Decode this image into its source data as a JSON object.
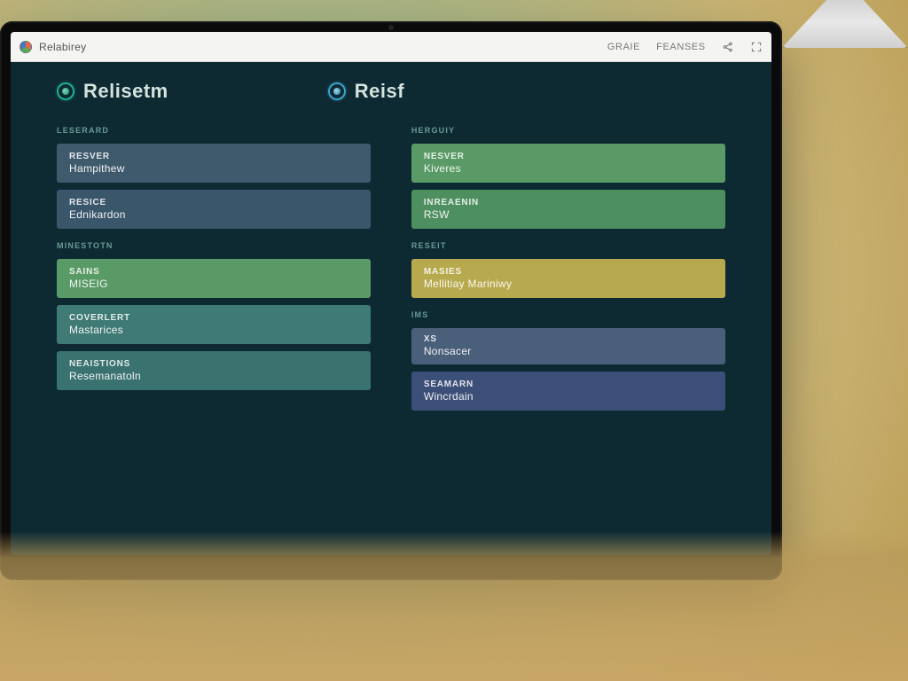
{
  "browser": {
    "title": "Relabirey",
    "nav": {
      "link1": "GRAIE",
      "link2": "FEANSES"
    }
  },
  "tabs": {
    "primary": "Relisetm",
    "secondary": "Reisf"
  },
  "left": {
    "sec1": {
      "label": "LESERARD"
    },
    "card1": {
      "line1": "Resver",
      "line2": "Hampithew"
    },
    "card2": {
      "line1": "Resice",
      "line2": "Ednikardon"
    },
    "sec2": {
      "label": "MINESTOTN"
    },
    "card3": {
      "line1": "SAINS",
      "line2": "MISEIG"
    },
    "card4": {
      "line1": "Coverlert",
      "line2": "Mastarices"
    },
    "card5": {
      "line1": "Neaistions",
      "line2": "Resemanatoln"
    }
  },
  "right": {
    "sec1": {
      "label": "HERGUIY"
    },
    "card1": {
      "line1": "Nesver",
      "line2": "Kiveres"
    },
    "card2": {
      "line1": "Inreaenin",
      "line2": "RSW"
    },
    "sec2": {
      "label": "RESEIT"
    },
    "card3": {
      "line1": "MASIES",
      "line2": "Mellitiay Mariniwy"
    },
    "sec3": {
      "label": "IMS"
    },
    "card4": {
      "line1": "XS",
      "line2": "Nonsacer"
    },
    "card5": {
      "line1": "Seamarn",
      "line2": "Wincrdain"
    }
  },
  "colors": {
    "bg": "#0d2a33",
    "accent": "#1fae8a",
    "slate": "#3f5a6d",
    "green": "#5a9a66",
    "olive": "#b7a94e",
    "navy": "#3c4f78"
  }
}
